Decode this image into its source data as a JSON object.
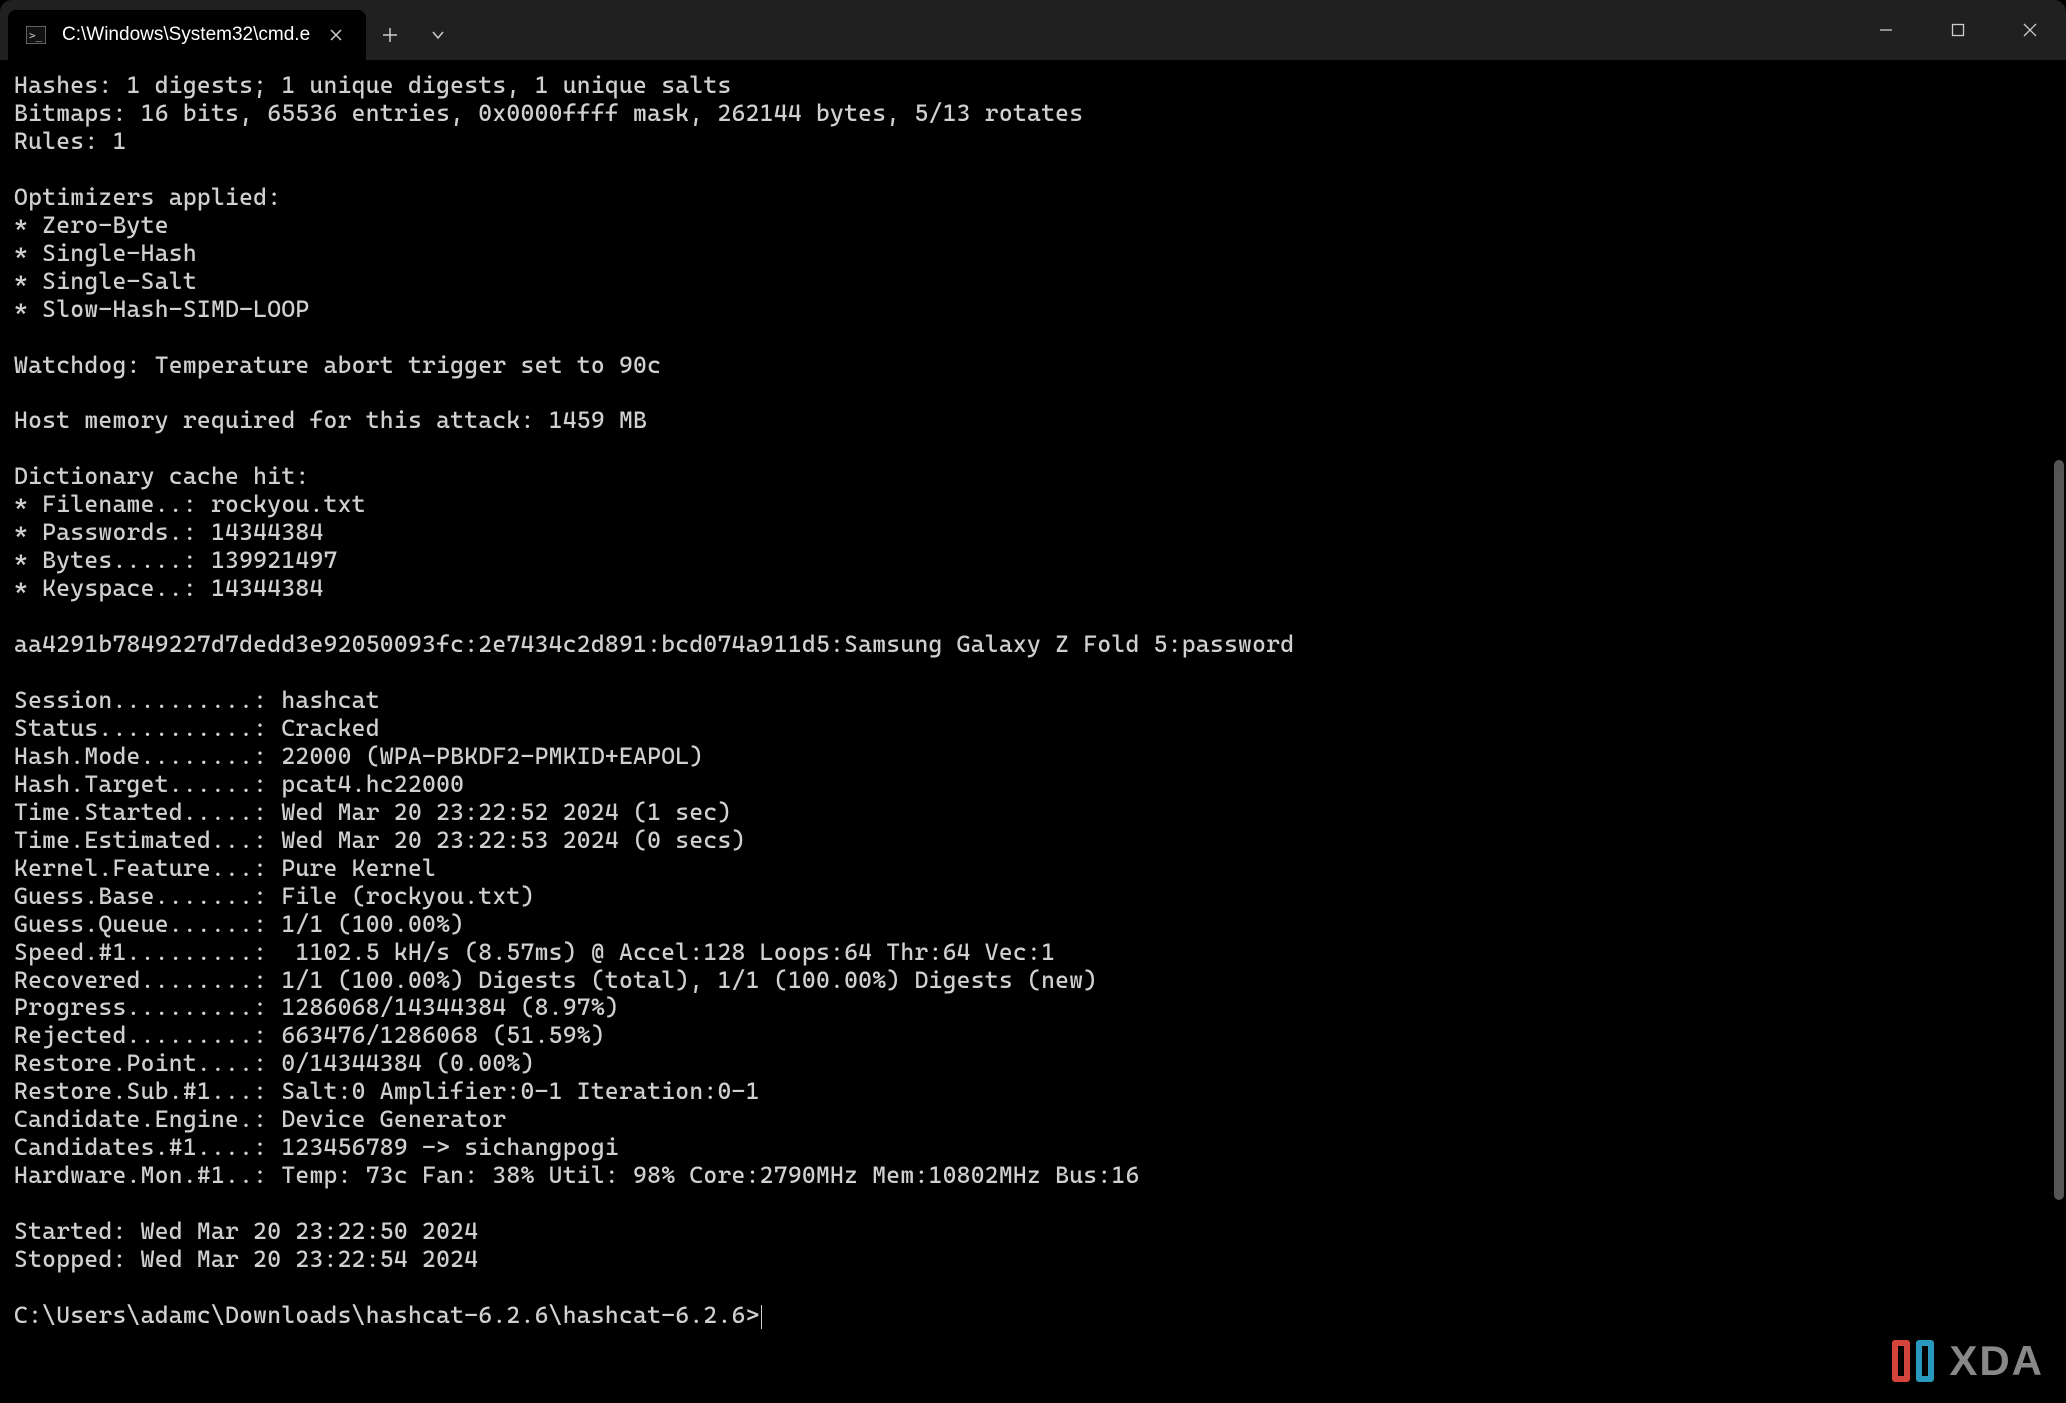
{
  "window": {
    "tab_title": "C:\\Windows\\System32\\cmd.e",
    "watermark_text": "XDA"
  },
  "output": {
    "hashes": "Hashes: 1 digests; 1 unique digests, 1 unique salts",
    "bitmaps": "Bitmaps: 16 bits, 65536 entries, 0x0000ffff mask, 262144 bytes, 5/13 rotates",
    "rules": "Rules: 1",
    "optimizers_header": "Optimizers applied:",
    "opt1": "* Zero-Byte",
    "opt2": "* Single-Hash",
    "opt3": "* Single-Salt",
    "opt4": "* Slow-Hash-SIMD-LOOP",
    "watchdog": "Watchdog: Temperature abort trigger set to 90c",
    "hostmem": "Host memory required for this attack: 1459 MB",
    "dict_header": "Dictionary cache hit:",
    "dict_file": "* Filename..: rockyou.txt",
    "dict_pass": "* Passwords.: 14344384",
    "dict_bytes": "* Bytes.....: 139921497",
    "dict_keyspace": "* Keyspace..: 14344384",
    "cracked": "aa4291b7849227d7dedd3e92050093fc:2e7434c2d891:bcd074a911d5:Samsung Galaxy Z Fold 5:password",
    "session": "Session..........: hashcat",
    "status": "Status...........: Cracked",
    "hashmode": "Hash.Mode........: 22000 (WPA-PBKDF2-PMKID+EAPOL)",
    "hashtarget": "Hash.Target......: pcat4.hc22000",
    "timestarted": "Time.Started.....: Wed Mar 20 23:22:52 2024 (1 sec)",
    "timeest": "Time.Estimated...: Wed Mar 20 23:22:53 2024 (0 secs)",
    "kernelfeat": "Kernel.Feature...: Pure Kernel",
    "guessbase": "Guess.Base.......: File (rockyou.txt)",
    "guessqueue": "Guess.Queue......: 1/1 (100.00%)",
    "speed": "Speed.#1.........:  1102.5 kH/s (8.57ms) @ Accel:128 Loops:64 Thr:64 Vec:1",
    "recovered": "Recovered........: 1/1 (100.00%) Digests (total), 1/1 (100.00%) Digests (new)",
    "progress": "Progress.........: 1286068/14344384 (8.97%)",
    "rejected": "Rejected.........: 663476/1286068 (51.59%)",
    "restorepoint": "Restore.Point....: 0/14344384 (0.00%)",
    "restoresub": "Restore.Sub.#1...: Salt:0 Amplifier:0-1 Iteration:0-1",
    "candengine": "Candidate.Engine.: Device Generator",
    "candidates": "Candidates.#1....: 123456789 -> sichangpogi",
    "hwmon": "Hardware.Mon.#1..: Temp: 73c Fan: 38% Util: 98% Core:2790MHz Mem:10802MHz Bus:16",
    "started": "Started: Wed Mar 20 23:22:50 2024",
    "stopped": "Stopped: Wed Mar 20 23:22:54 2024",
    "prompt": "C:\\Users\\adamc\\Downloads\\hashcat-6.2.6\\hashcat-6.2.6>"
  }
}
